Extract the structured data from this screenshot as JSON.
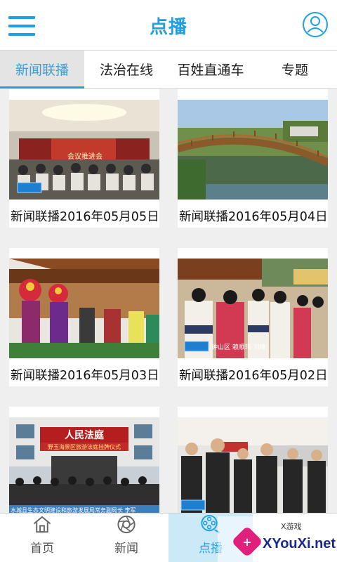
{
  "header": {
    "title": "点播",
    "menu_icon": "hamburger-menu-icon",
    "user_icon": "user-profile-icon"
  },
  "tabs": [
    {
      "label": "新闻联播",
      "active": true
    },
    {
      "label": "法治在线",
      "active": false
    },
    {
      "label": "百姓直通车",
      "active": false
    },
    {
      "label": "专题",
      "active": false
    }
  ],
  "videos": [
    {
      "title": "新闻联播2016年05月05日"
    },
    {
      "title": "新闻联播2016年05月04日"
    },
    {
      "title": "新闻联播2016年05月03日"
    },
    {
      "title": "新闻联播2016年05月02日"
    },
    {
      "title": ""
    },
    {
      "title": ""
    }
  ],
  "thumb_text": {
    "banner1": "会议推进会",
    "court_sign": "人民法庭",
    "court_banner": "野玉海景区旅游法庭挂牌仪式",
    "caption": "水城县生态文明建设和旅游发展局常务副局长 李军",
    "caption4": "钟山区 赖顺玮 刘峰"
  },
  "bottom_nav": [
    {
      "label": "首页",
      "icon": "home-icon",
      "active": false
    },
    {
      "label": "新闻",
      "icon": "camera-aperture-icon",
      "active": false
    },
    {
      "label": "点播",
      "icon": "film-reel-icon",
      "active": true
    },
    {
      "label": "",
      "icon": "",
      "active": false
    }
  ],
  "watermark": {
    "top": "X游戏",
    "text": "XYouXi.net"
  },
  "colors": {
    "accent": "#1ea0e2",
    "active_tab_bg": "#e4e4e4",
    "active_nav_bg": "#cce9f8"
  }
}
